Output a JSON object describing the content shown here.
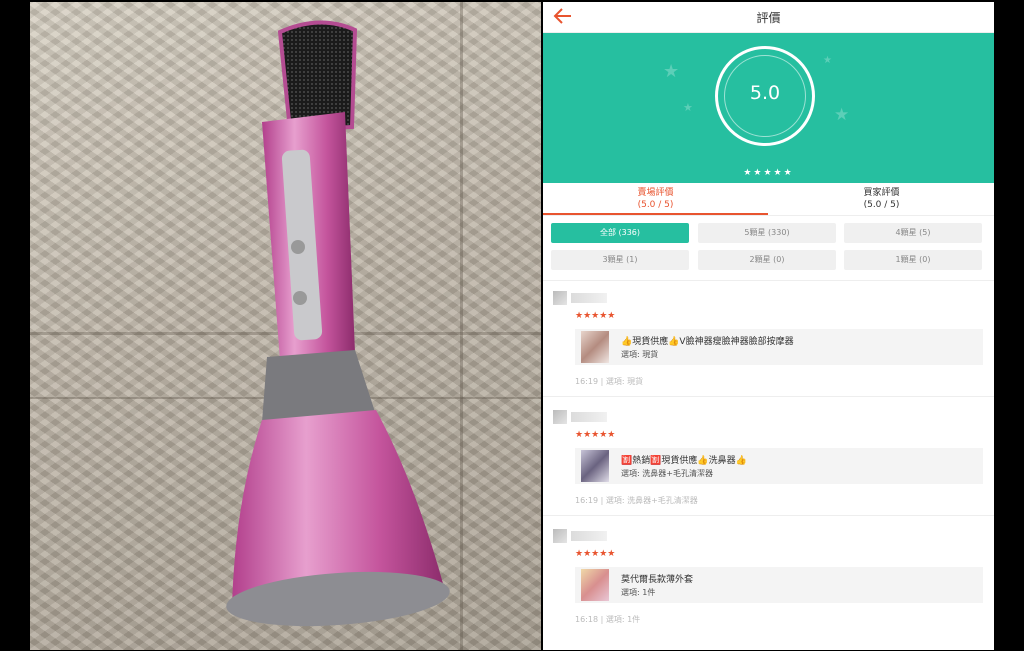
{
  "header": {
    "title": "評價"
  },
  "summary": {
    "score": "5.0",
    "stars": "★★★★★"
  },
  "tabs": [
    {
      "label": "賣場評價",
      "sub": "(5.0 / 5)"
    },
    {
      "label": "買家評價",
      "sub": "(5.0 / 5)"
    }
  ],
  "filters": [
    {
      "label": "全部 (336)"
    },
    {
      "label": "5顆星 (330)"
    },
    {
      "label": "4顆星 (5)"
    },
    {
      "label": "3顆星 (1)"
    },
    {
      "label": "2顆星 (0)"
    },
    {
      "label": "1顆星 (0)"
    }
  ],
  "reviews": [
    {
      "stars": "★★★★★",
      "item": "👍現貨供應👍V臉神器瘦臉神器臉部按摩器",
      "option": "選項: 現貨",
      "time": "16:19",
      "meta_option": "選項: 現貨"
    },
    {
      "stars": "★★★★★",
      "item": "🈹熱銷🈹現貨供應👍洗鼻器👍",
      "option": "選項: 洗鼻器+毛孔清潔器",
      "time": "16:19",
      "meta_option": "選項: 洗鼻器+毛孔清潔器"
    },
    {
      "stars": "★★★★★",
      "item": "莫代爾長款薄外套",
      "option": "選項: 1件",
      "time": "16:18",
      "meta_option": "選項: 1件"
    }
  ],
  "colors": {
    "accent": "#26bfa0",
    "brand": "#e8542f"
  },
  "icons": {
    "back": "arrow-left-icon",
    "decoration": "star-icon"
  }
}
